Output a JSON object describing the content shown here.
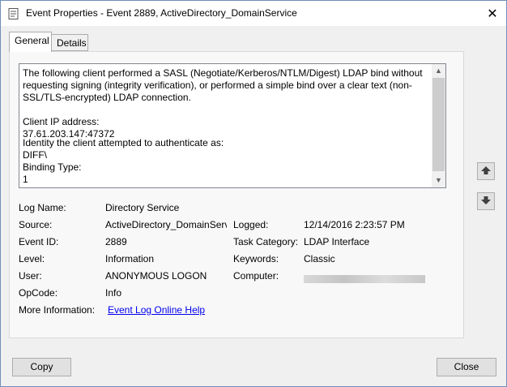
{
  "window": {
    "title": "Event Properties - Event 2889, ActiveDirectory_DomainService",
    "close_glyph": "✕"
  },
  "tabs": [
    {
      "label": "General",
      "active": true
    },
    {
      "label": "Details",
      "active": false
    }
  ],
  "description": {
    "line1": "The following client performed a SASL (Negotiate/Kerberos/NTLM/Digest) LDAP bind without",
    "line2": "requesting signing (integrity verification), or performed a simple bind over a clear text (non-",
    "line3": "SSL/TLS-encrypted) LDAP connection.",
    "client_ip_label": "Client IP address:",
    "client_ip_value": "37.61.203.147:47372",
    "identity_label": "Identity the client attempted to authenticate as:",
    "identity_prefix": "DIFF\\",
    "binding_type_label": "Binding Type:",
    "binding_type_value": "1"
  },
  "details": {
    "log_name_label": "Log Name:",
    "log_name_value": "Directory Service",
    "source_label": "Source:",
    "source_value": "ActiveDirectory_DomainServ",
    "logged_label": "Logged:",
    "logged_value": "12/14/2016 2:23:57 PM",
    "event_id_label": "Event ID:",
    "event_id_value": "2889",
    "task_category_label": "Task Category:",
    "task_category_value": "LDAP Interface",
    "level_label": "Level:",
    "level_value": "Information",
    "keywords_label": "Keywords:",
    "keywords_value": "Classic",
    "user_label": "User:",
    "user_value": "ANONYMOUS LOGON",
    "computer_label": "Computer:",
    "opcode_label": "OpCode:",
    "opcode_value": "Info",
    "more_info_label": "More Information:",
    "more_info_link": "Event Log Online Help"
  },
  "buttons": {
    "copy": "Copy",
    "close": "Close"
  },
  "icons": {
    "title": "event-properties-icon",
    "up": "arrow-up-icon",
    "down": "arrow-down-icon"
  }
}
